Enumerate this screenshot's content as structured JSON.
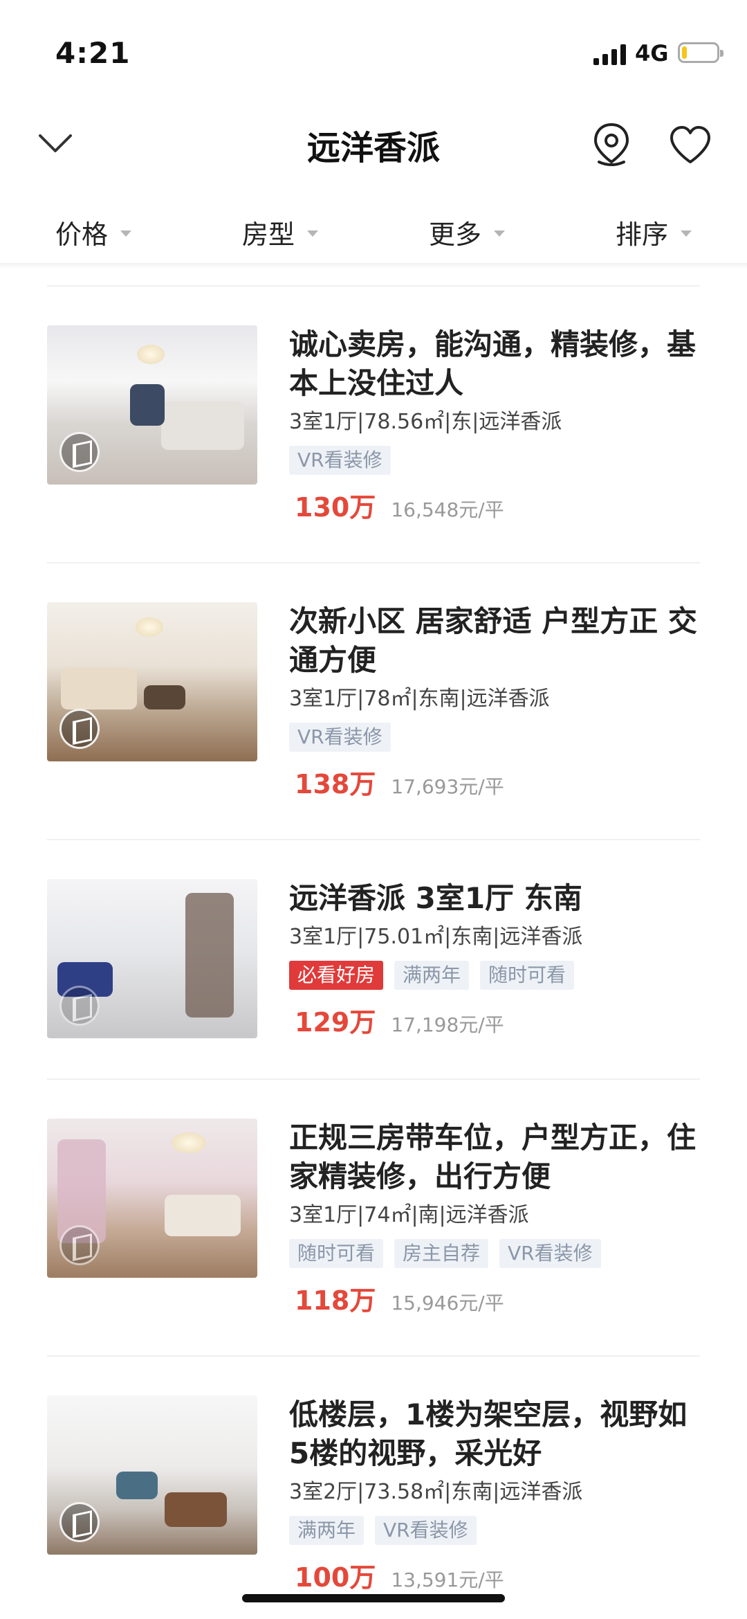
{
  "status_bar": {
    "time": "4:21",
    "network": "4G",
    "battery_level": 0.15
  },
  "nav": {
    "title": "远洋香派",
    "icons": [
      "chevron-down-icon",
      "map-pin-icon",
      "heart-icon"
    ]
  },
  "filters": [
    {
      "label": "价格"
    },
    {
      "label": "房型"
    },
    {
      "label": "更多"
    },
    {
      "label": "排序"
    }
  ],
  "listings": [
    {
      "title": "诚心卖房，能沟通，精装修，基本上没住过人",
      "meta": "3室1厅|78.56㎡|东|远洋香派",
      "tags": [
        "VR看装修"
      ],
      "price": "130万",
      "unit_price": "16,548元/平"
    },
    {
      "title": "次新小区 居家舒适 户型方正 交通方便",
      "meta": "3室1厅|78㎡|东南|远洋香派",
      "tags": [
        "VR看装修"
      ],
      "price": "138万",
      "unit_price": "17,693元/平"
    },
    {
      "title": "远洋香派 3室1厅 东南",
      "meta": "3室1厅|75.01㎡|东南|远洋香派",
      "tags": [
        "必看好房",
        "满两年",
        "随时可看"
      ],
      "price": "129万",
      "unit_price": "17,198元/平"
    },
    {
      "title": "正规三房带车位，户型方正，住家精装修，出行方便",
      "meta": "3室1厅|74㎡|南|远洋香派",
      "tags": [
        "随时可看",
        "房主自荐",
        "VR看装修"
      ],
      "price": "118万",
      "unit_price": "15,946元/平"
    },
    {
      "title": "低楼层，1楼为架空层，视野如5楼的视野，采光好",
      "meta": "3室2厅|73.58㎡|东南|远洋香派",
      "tags": [
        "满两年",
        "VR看装修"
      ],
      "price": "100万",
      "unit_price": "13,591元/平"
    }
  ],
  "colors": {
    "price": "#e4483a",
    "hot_tag_bg": "#e03a3a",
    "tag_bg": "#eef2f7",
    "tag_text": "#8b97a8"
  }
}
